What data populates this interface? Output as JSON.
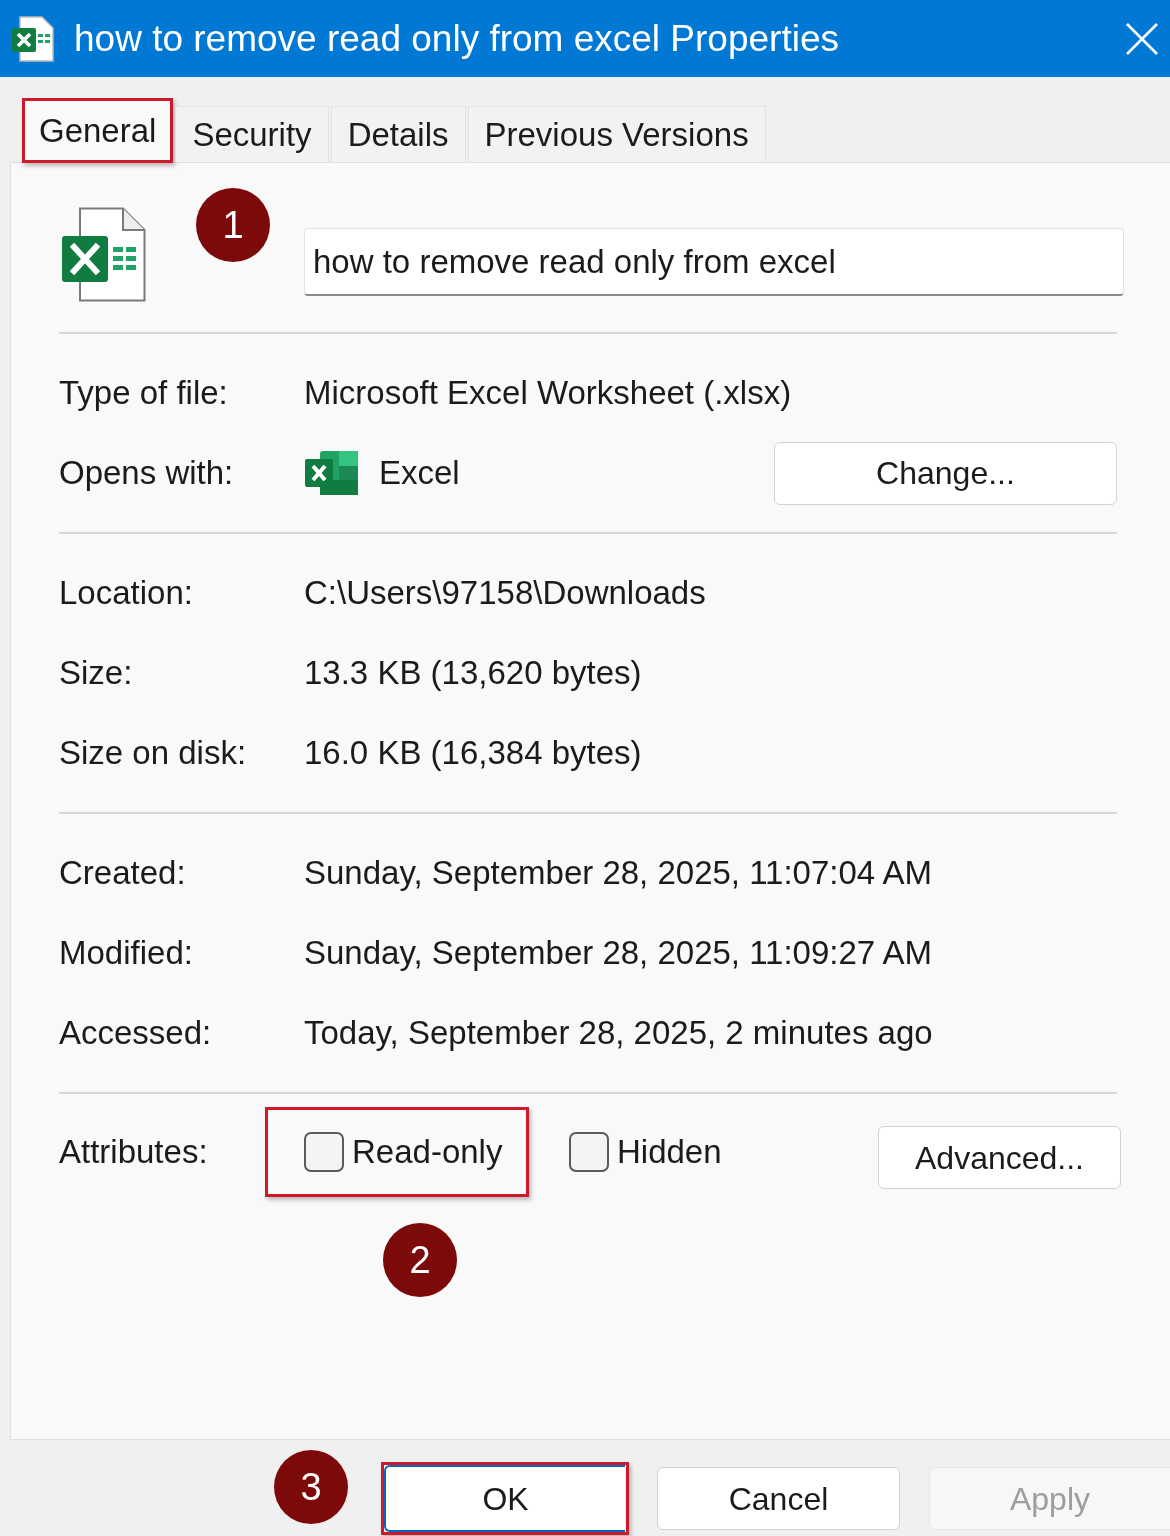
{
  "window": {
    "title": "how to remove read only from excel Properties"
  },
  "tabs": [
    {
      "label": "General",
      "selected": true,
      "highlighted": true,
      "marker": "1"
    },
    {
      "label": "Security",
      "selected": false,
      "highlighted": false
    },
    {
      "label": "Details",
      "selected": false,
      "highlighted": false
    },
    {
      "label": "Previous Versions",
      "selected": false,
      "highlighted": false
    }
  ],
  "file_name": {
    "value": "how to remove read only from excel"
  },
  "sections": [
    [
      {
        "kind": "text",
        "label": "Type of file:",
        "value": "Microsoft Excel Worksheet (.xlsx)"
      },
      {
        "kind": "app",
        "label": "Opens with:",
        "value": "Excel",
        "button": "Change..."
      }
    ],
    [
      {
        "kind": "text",
        "label": "Location:",
        "value": "C:\\Users\\97158\\Downloads"
      },
      {
        "kind": "text",
        "label": "Size:",
        "value": "13.3 KB (13,620 bytes)"
      },
      {
        "kind": "text",
        "label": "Size on disk:",
        "value": "16.0 KB (16,384 bytes)"
      }
    ],
    [
      {
        "kind": "text",
        "label": "Created:",
        "value": "Sunday, September 28, 2025, 11:07:04 AM"
      },
      {
        "kind": "text",
        "label": "Modified:",
        "value": "Sunday, September 28, 2025, 11:09:27 AM"
      },
      {
        "kind": "text",
        "label": "Accessed:",
        "value": "Today, September 28, 2025, 2 minutes ago"
      }
    ]
  ],
  "attributes": {
    "label": "Attributes:",
    "checkboxes": [
      {
        "label": "Read-only",
        "checked": false,
        "highlighted": true,
        "marker": "2"
      },
      {
        "label": "Hidden",
        "checked": false,
        "highlighted": false
      }
    ],
    "button": "Advanced..."
  },
  "buttons": [
    {
      "label": "OK",
      "default": true,
      "disabled": false,
      "highlighted": true,
      "marker": "3"
    },
    {
      "label": "Cancel",
      "default": false,
      "disabled": false,
      "highlighted": false
    },
    {
      "label": "Apply",
      "default": false,
      "disabled": true,
      "highlighted": false
    }
  ]
}
